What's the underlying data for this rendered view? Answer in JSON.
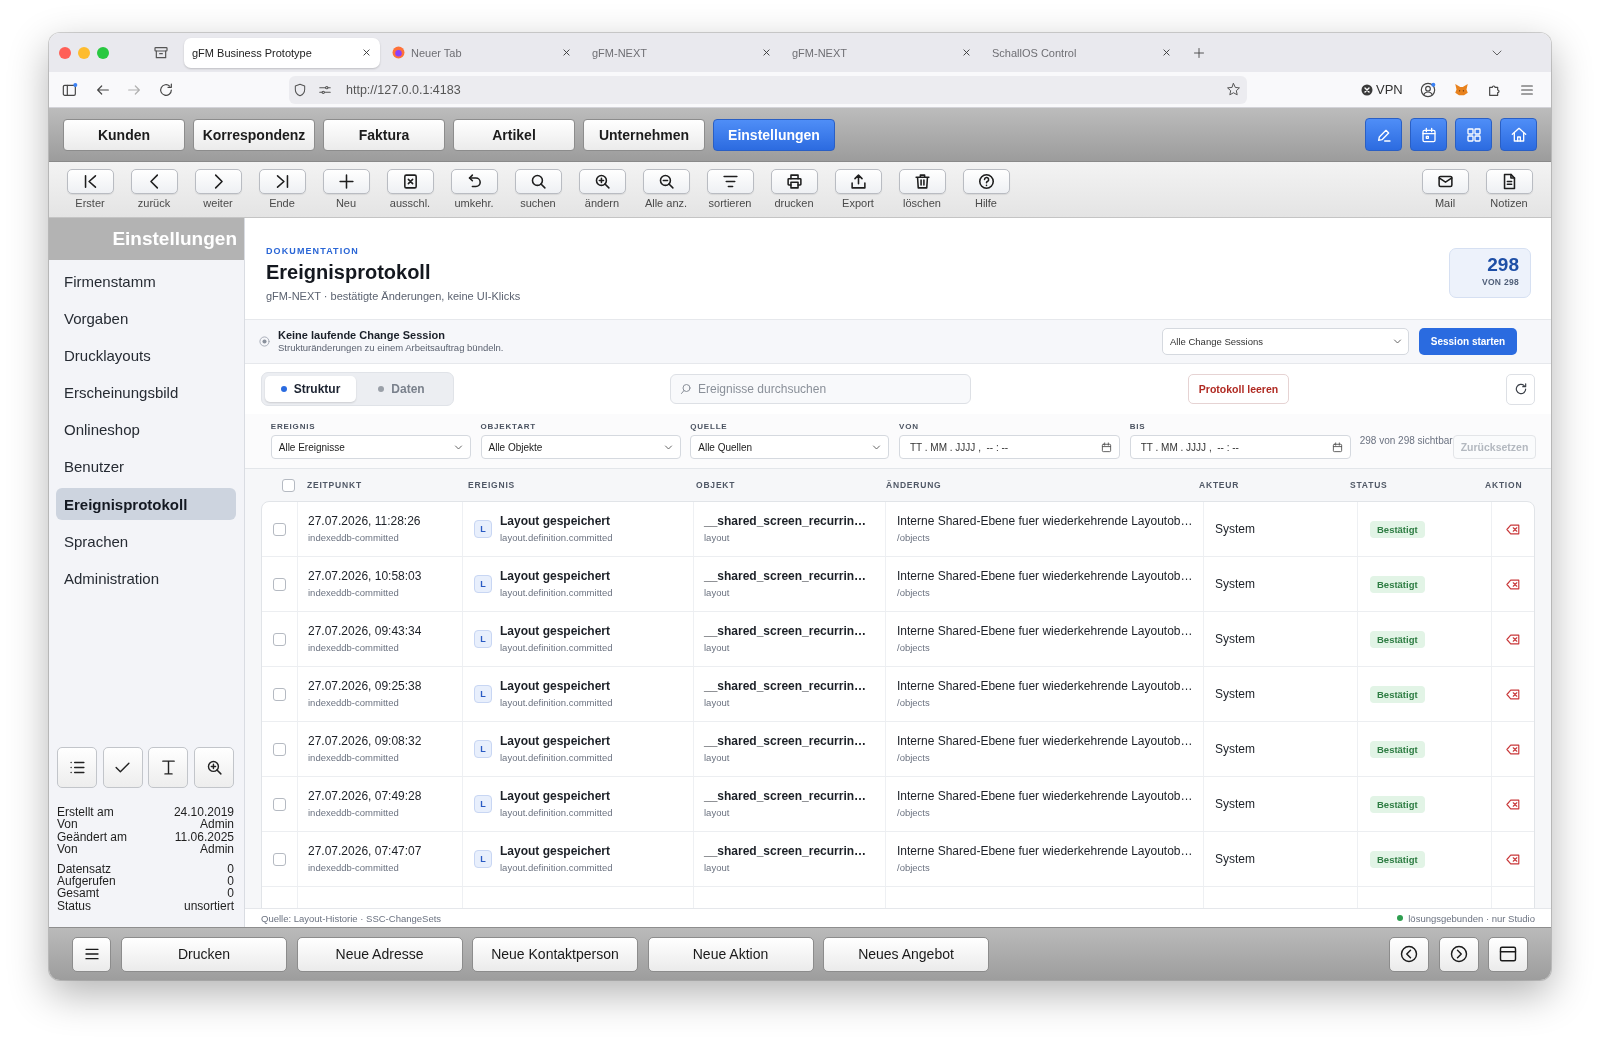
{
  "browser": {
    "tabs": [
      {
        "title": "gFM Business Prototype",
        "kind": "plain",
        "selected": true
      },
      {
        "title": "Neuer Tab",
        "kind": "logo",
        "selected": false
      },
      {
        "title": "gFM-NEXT",
        "kind": "plain",
        "selected": false
      },
      {
        "title": "gFM-NEXT",
        "kind": "plain",
        "selected": false
      },
      {
        "title": "SchallOS Control",
        "kind": "plain",
        "selected": false
      }
    ],
    "url": "http://127.0.0.1:4183",
    "vpn": "VPN"
  },
  "modules": [
    {
      "label": "Kunden",
      "selected": false
    },
    {
      "label": "Korrespondenz",
      "selected": false
    },
    {
      "label": "Faktura",
      "selected": false
    },
    {
      "label": "Artikel",
      "selected": false
    },
    {
      "label": "Unternehmen",
      "selected": false
    },
    {
      "label": "Einstellungen",
      "selected": true
    }
  ],
  "quick_actions": [
    {
      "kind": "edit"
    },
    {
      "kind": "calendar"
    },
    {
      "kind": "grid"
    },
    {
      "kind": "home"
    }
  ],
  "toolbar": {
    "left": [
      {
        "label": "Erster",
        "kind": "first"
      },
      {
        "label": "zurück",
        "kind": "prev"
      },
      {
        "label": "weiter",
        "kind": "next"
      },
      {
        "label": "Ende",
        "kind": "last"
      },
      {
        "label": "Neu",
        "kind": "new"
      },
      {
        "label": "ausschl.",
        "kind": "exclude"
      },
      {
        "label": "umkehr.",
        "kind": "invert"
      },
      {
        "label": "suchen",
        "kind": "search"
      },
      {
        "label": "ändern",
        "kind": "zoomin"
      },
      {
        "label": "Alle anz.",
        "kind": "zoomout"
      },
      {
        "label": "sortieren",
        "kind": "sort"
      },
      {
        "label": "drucken",
        "kind": "print"
      },
      {
        "label": "Export",
        "kind": "export"
      },
      {
        "label": "löschen",
        "kind": "delete"
      },
      {
        "label": "Hilfe",
        "kind": "help"
      }
    ],
    "right": [
      {
        "label": "Mail",
        "kind": "mail"
      },
      {
        "label": "Notizen",
        "kind": "notes"
      }
    ]
  },
  "sidebar": {
    "title": "Einstellungen",
    "items": [
      {
        "label": "Firmenstamm",
        "selected": false
      },
      {
        "label": "Vorgaben",
        "selected": false
      },
      {
        "label": "Drucklayouts",
        "selected": false
      },
      {
        "label": "Erscheinungsbild",
        "selected": false
      },
      {
        "label": "Onlineshop",
        "selected": false
      },
      {
        "label": "Benutzer",
        "selected": false
      },
      {
        "label": "Ereignisprotokoll",
        "selected": true
      },
      {
        "label": "Sprachen",
        "selected": false
      },
      {
        "label": "Administration",
        "selected": false
      }
    ],
    "tools": [
      {
        "kind": "list"
      },
      {
        "kind": "check"
      },
      {
        "kind": "text"
      },
      {
        "kind": "zoom"
      }
    ],
    "meta": [
      {
        "label": "Erstellt am",
        "value": "24.10.2019"
      },
      {
        "label": "Von",
        "value": "Admin"
      },
      {
        "label": "Geändert am",
        "value": "11.06.2025"
      },
      {
        "label": "Von",
        "value": "Admin"
      }
    ],
    "stats": [
      {
        "label": "Datensatz",
        "value": "0"
      },
      {
        "label": "Aufgerufen",
        "value": "0"
      },
      {
        "label": "Gesamt",
        "value": "0"
      },
      {
        "label": "Status",
        "value": "unsortiert"
      }
    ]
  },
  "header": {
    "eyebrow": "DOKUMENTATION",
    "title": "Ereignisprotokoll",
    "subtitle": "gFM-NEXT · bestätigte Änderungen, keine UI-Klicks",
    "count": "298",
    "count_total": "VON 298"
  },
  "session": {
    "title": "Keine laufende Change Session",
    "hint": "Strukturänderungen zu einem Arbeitsauftrag bündeln.",
    "select": "Alle Change Sessions",
    "button": "Session starten"
  },
  "view_tabs": [
    {
      "label": "Struktur",
      "selected": true
    },
    {
      "label": "Daten",
      "selected": false
    }
  ],
  "search": {
    "placeholder": "Ereignisse durchsuchen"
  },
  "clear_button": "Protokoll leeren",
  "filters": [
    {
      "label": "EREIGNIS",
      "kind": "select",
      "value": "Alle Ereignisse"
    },
    {
      "label": "OBJEKTART",
      "kind": "select",
      "value": "Alle Objekte"
    },
    {
      "label": "QUELLE",
      "kind": "select",
      "value": "Alle Quellen"
    },
    {
      "label": "VON",
      "kind": "date",
      "placeholder": "TT . MM . JJJJ ,  -- : --"
    },
    {
      "label": "BIS",
      "kind": "date",
      "placeholder": "TT . MM . JJJJ ,  -- : --"
    }
  ],
  "visible_count": "298 von 298 sichtbar",
  "reset_button": {
    "label": "Zurücksetzen",
    "disabled": true
  },
  "table": {
    "all_checked": false,
    "columns": [
      "ZEITPUNKT",
      "EREIGNIS",
      "OBJEKT",
      "ÄNDERUNG",
      "AKTEUR",
      "STATUS",
      "AKTION"
    ],
    "rows": [
      {
        "checked": false,
        "time": "27.07.2026, 11:28:26",
        "source": "indexeddb-committed",
        "badge": "L",
        "event": "Layout gespeichert",
        "event_key": "layout.definition.committed",
        "object": "__shared_screen_recurrin…",
        "object_type": "layout",
        "change": "Interne Shared-Ebene fuer wiederkehrende Layoutob…",
        "path": "/objects",
        "actor": "System",
        "status": "Bestätigt"
      },
      {
        "checked": false,
        "time": "27.07.2026, 10:58:03",
        "source": "indexeddb-committed",
        "badge": "L",
        "event": "Layout gespeichert",
        "event_key": "layout.definition.committed",
        "object": "__shared_screen_recurrin…",
        "object_type": "layout",
        "change": "Interne Shared-Ebene fuer wiederkehrende Layoutob…",
        "path": "/objects",
        "actor": "System",
        "status": "Bestätigt"
      },
      {
        "checked": false,
        "time": "27.07.2026, 09:43:34",
        "source": "indexeddb-committed",
        "badge": "L",
        "event": "Layout gespeichert",
        "event_key": "layout.definition.committed",
        "object": "__shared_screen_recurrin…",
        "object_type": "layout",
        "change": "Interne Shared-Ebene fuer wiederkehrende Layoutob…",
        "path": "/objects",
        "actor": "System",
        "status": "Bestätigt"
      },
      {
        "checked": false,
        "time": "27.07.2026, 09:25:38",
        "source": "indexeddb-committed",
        "badge": "L",
        "event": "Layout gespeichert",
        "event_key": "layout.definition.committed",
        "object": "__shared_screen_recurrin…",
        "object_type": "layout",
        "change": "Interne Shared-Ebene fuer wiederkehrende Layoutob…",
        "path": "/objects",
        "actor": "System",
        "status": "Bestätigt"
      },
      {
        "checked": false,
        "time": "27.07.2026, 09:08:32",
        "source": "indexeddb-committed",
        "badge": "L",
        "event": "Layout gespeichert",
        "event_key": "layout.definition.committed",
        "object": "__shared_screen_recurrin…",
        "object_type": "layout",
        "change": "Interne Shared-Ebene fuer wiederkehrende Layoutob…",
        "path": "/objects",
        "actor": "System",
        "status": "Bestätigt"
      },
      {
        "checked": false,
        "time": "27.07.2026, 07:49:28",
        "source": "indexeddb-committed",
        "badge": "L",
        "event": "Layout gespeichert",
        "event_key": "layout.definition.committed",
        "object": "__shared_screen_recurrin…",
        "object_type": "layout",
        "change": "Interne Shared-Ebene fuer wiederkehrende Layoutob…",
        "path": "/objects",
        "actor": "System",
        "status": "Bestätigt"
      },
      {
        "checked": false,
        "time": "27.07.2026, 07:47:07",
        "source": "indexeddb-committed",
        "badge": "L",
        "event": "Layout gespeichert",
        "event_key": "layout.definition.committed",
        "object": "__shared_screen_recurrin…",
        "object_type": "layout",
        "change": "Interne Shared-Ebene fuer wiederkehrende Layoutob…",
        "path": "/objects",
        "actor": "System",
        "status": "Bestätigt"
      }
    ]
  },
  "status_bar": {
    "source": "Quelle: Layout-Historie · SSC-ChangeSets",
    "scope": "lösungsgebunden · nur Studio"
  },
  "footer": {
    "buttons": [
      "Drucken",
      "Neue Adresse",
      "Neue Kontaktperson",
      "Neue Aktion",
      "Neues Angebot"
    ],
    "nav": [
      {
        "kind": "back"
      },
      {
        "kind": "forward"
      },
      {
        "kind": "panel"
      }
    ]
  }
}
